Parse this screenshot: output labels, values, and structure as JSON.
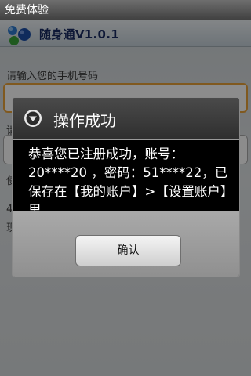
{
  "statusbar": {
    "title": "免费体验"
  },
  "header": {
    "app_title": "随身通V1.0.1"
  },
  "form": {
    "phone_label": "请输入您的手机号码",
    "phone_value": "",
    "label_2": "请",
    "label_3": "使",
    "label_4": "4",
    "label_5": "现"
  },
  "dialog": {
    "title": "操作成功",
    "message": "恭喜您已注册成功，账号：20****20 ，密码：51****22，已保存在【我的账户】>【设置账户】里。",
    "confirm_label": "确认"
  },
  "colors": {
    "focus_border": "#e9a23a",
    "dialog_bg": "#424242",
    "dialog_body": "#000000"
  }
}
